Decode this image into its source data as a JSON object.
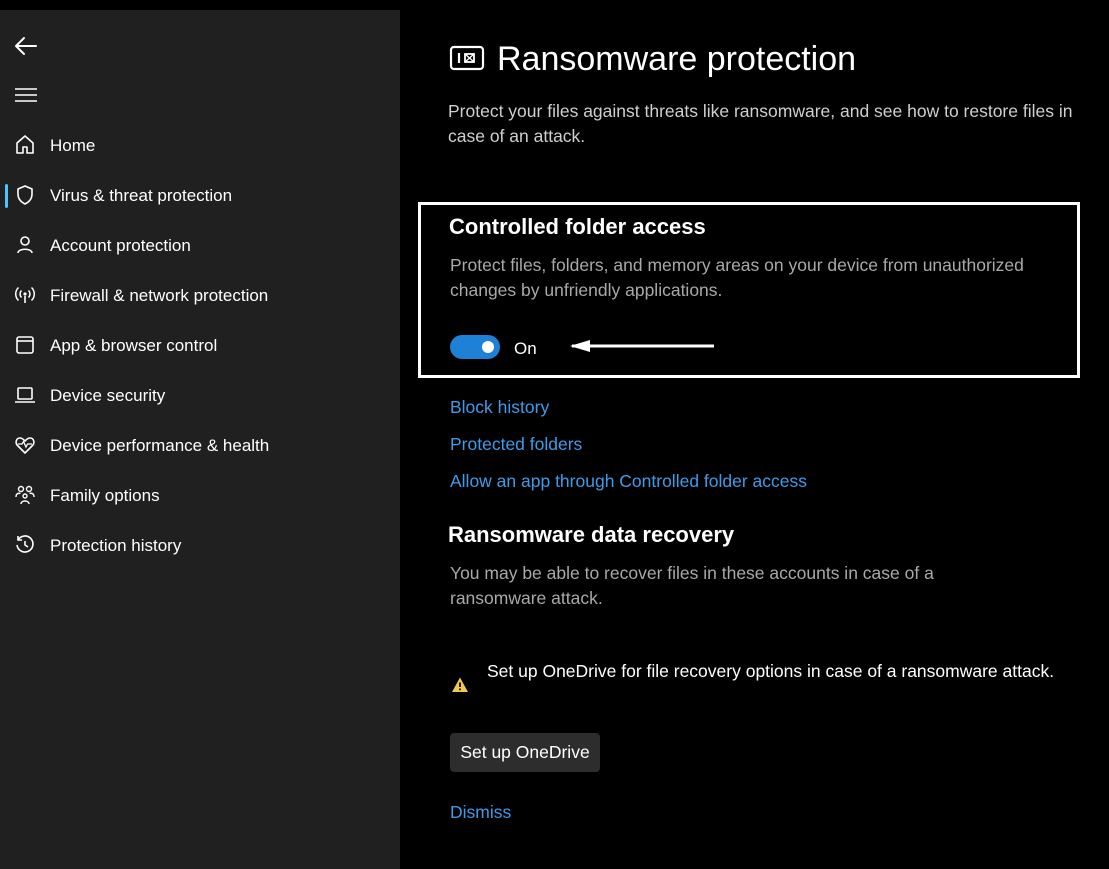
{
  "sidebar": {
    "back_icon": "back-arrow-icon",
    "menu_icon": "hamburger-menu-icon",
    "selected_index": 1,
    "accent_color": "#4cc2ff",
    "items": [
      {
        "label": "Home",
        "icon": "home-icon"
      },
      {
        "label": "Virus & threat protection",
        "icon": "shield-icon"
      },
      {
        "label": "Account protection",
        "icon": "person-icon"
      },
      {
        "label": "Firewall & network protection",
        "icon": "wireless-antenna-icon"
      },
      {
        "label": "App & browser control",
        "icon": "browser-window-icon"
      },
      {
        "label": "Device security",
        "icon": "laptop-icon"
      },
      {
        "label": "Device performance & health",
        "icon": "heart-pulse-icon"
      },
      {
        "label": "Family options",
        "icon": "family-icon"
      },
      {
        "label": "Protection history",
        "icon": "history-clock-icon"
      }
    ]
  },
  "main": {
    "page_icon": "ransomware-icon",
    "title": "Ransomware protection",
    "description": "Protect your files against threats like ransomware, and see how to restore files in case of an attack.",
    "controlled_folder_access": {
      "title": "Controlled folder access",
      "description": "Protect files, folders, and memory areas on your device from unauthorized changes by unfriendly applications.",
      "toggle_state": "On",
      "toggle_on": true,
      "toggle_color": "#1e80d6"
    },
    "links": {
      "block_history": "Block history",
      "protected_folders": "Protected folders",
      "allow_app": "Allow an app through Controlled folder access"
    },
    "data_recovery": {
      "title": "Ransomware data recovery",
      "description": "You may be able to recover files in these accounts in case of a ransomware attack.",
      "warning_icon": "warning-triangle-icon",
      "warning_color": "#f2c94c",
      "warning_text": "Set up OneDrive for file recovery options in case of a ransomware attack.",
      "button_label": "Set up OneDrive",
      "dismiss_label": "Dismiss"
    },
    "link_color": "#3e9bea"
  }
}
